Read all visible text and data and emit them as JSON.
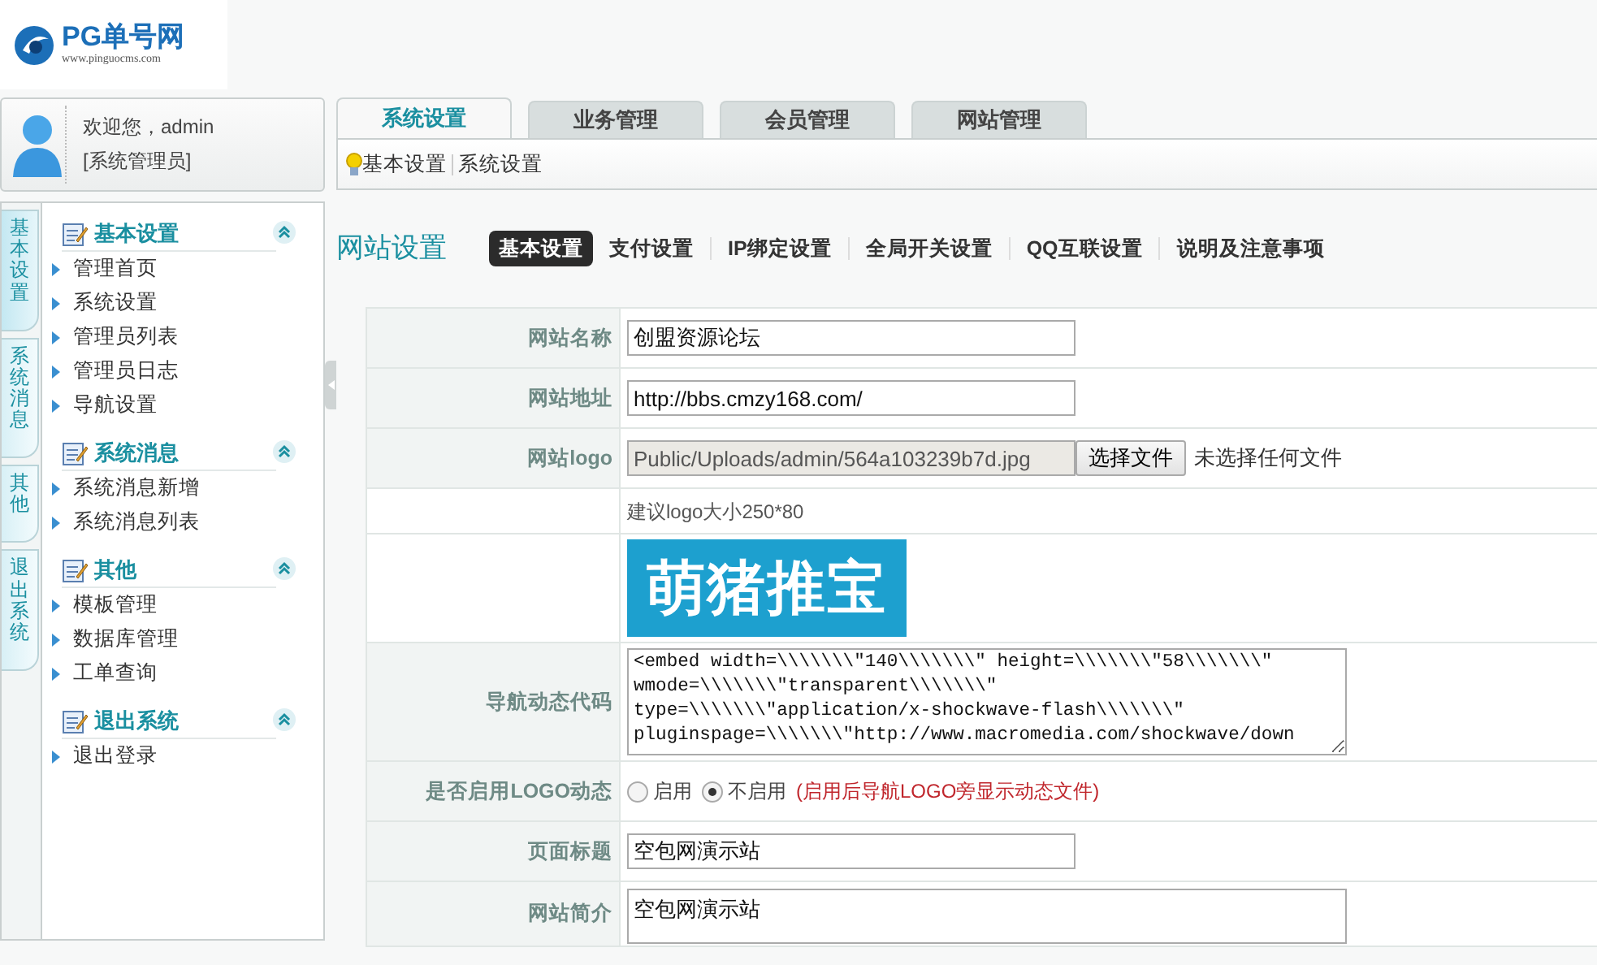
{
  "logo": {
    "title": "PG单号网",
    "subtitle": "www.pinguocms.com"
  },
  "user": {
    "greeting": "欢迎您，admin",
    "role": "[系统管理员]"
  },
  "side_tabs": [
    {
      "label": "基本设置",
      "selected": true
    },
    {
      "label": "系统消息",
      "selected": false
    },
    {
      "label": "其他",
      "selected": false
    },
    {
      "label": "退出系统",
      "selected": false
    }
  ],
  "sidebar": {
    "groups": [
      {
        "title": "基本设置",
        "expanded": true,
        "items": [
          "管理首页",
          "系统设置",
          "管理员列表",
          "管理员日志",
          "导航设置"
        ]
      },
      {
        "title": "系统消息",
        "expanded": true,
        "items": [
          "系统消息新增",
          "系统消息列表"
        ]
      },
      {
        "title": "其他",
        "expanded": true,
        "items": [
          "模板管理",
          "数据库管理",
          "工单查询"
        ]
      },
      {
        "title": "退出系统",
        "expanded": true,
        "items": [
          "退出登录"
        ]
      }
    ]
  },
  "tabs": [
    {
      "label": "系统设置",
      "selected": true
    },
    {
      "label": "业务管理",
      "selected": false
    },
    {
      "label": "会员管理",
      "selected": false
    },
    {
      "label": "网站管理",
      "selected": false
    }
  ],
  "breadcrumb": [
    "基本设置",
    "系统设置"
  ],
  "section": {
    "title": "网站设置",
    "tabs": [
      {
        "label": "基本设置",
        "selected": true
      },
      {
        "label": "支付设置",
        "selected": false
      },
      {
        "label": "IP绑定设置",
        "selected": false
      },
      {
        "label": "全局开关设置",
        "selected": false
      },
      {
        "label": "QQ互联设置",
        "selected": false
      },
      {
        "label": "说明及注意事项",
        "selected": false
      }
    ]
  },
  "form": [
    {
      "kind": "text",
      "label": "网站名称",
      "value": "创盟资源论坛"
    },
    {
      "kind": "text",
      "label": "网站地址",
      "value": "http://bbs.cmzy168.com/"
    },
    {
      "kind": "file",
      "label": "网站logo",
      "value": "Public/Uploads/admin/564a103239b7d.jpg",
      "button": "选择文件",
      "status": "未选择任何文件"
    },
    {
      "kind": "hint",
      "text": "建议logo大小250*80"
    },
    {
      "kind": "image",
      "text": "萌猪推宝"
    },
    {
      "kind": "code",
      "label": "导航动态代码",
      "value": "<embed width=\\\\\\\\\\\\\\\"140\\\\\\\\\\\\\\\" height=\\\\\\\\\\\\\\\"58\\\\\\\\\\\\\\\"\nwmode=\\\\\\\\\\\\\\\"transparent\\\\\\\\\\\\\\\"\ntype=\\\\\\\\\\\\\\\"application/x-shockwave-flash\\\\\\\\\\\\\\\"\npluginspage=\\\\\\\\\\\\\\\"http://www.macromedia.com/shockwave/down"
    },
    {
      "kind": "radio",
      "label": "是否启用LOGO动态",
      "options": [
        {
          "label": "启用",
          "selected": false
        },
        {
          "label": "不启用",
          "selected": true
        }
      ],
      "note": "(启用后导航LOGO旁显示动态文件)"
    },
    {
      "kind": "text",
      "label": "页面标题",
      "value": "空包网演示站"
    },
    {
      "kind": "textarea",
      "label": "网站简介",
      "value": "空包网演示站"
    }
  ]
}
